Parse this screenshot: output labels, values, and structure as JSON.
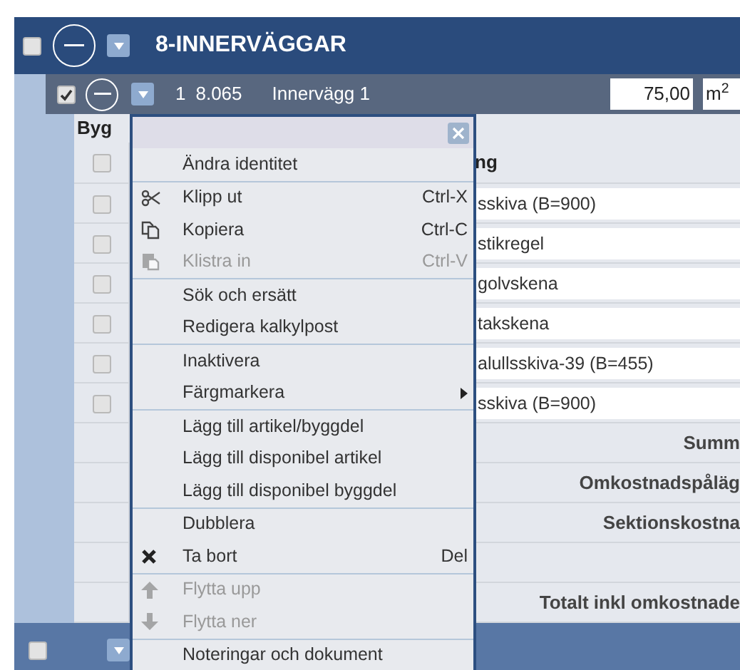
{
  "section": {
    "checked": false,
    "title": "8-INNERVÄGGAR"
  },
  "subsection": {
    "checked": true,
    "number": "1",
    "code": "8.065",
    "name": "Innervägg 1",
    "quantity": "75,00",
    "unit": "m$^{2}$"
  },
  "table": {
    "header": {
      "column_1": "Byg",
      "checked": false,
      "column_2": "ng"
    },
    "rows": [
      {
        "checked": false,
        "text": "sskiva (B=900)"
      },
      {
        "checked": false,
        "text": "stikregel"
      },
      {
        "checked": false,
        "text": "golvskena"
      },
      {
        "checked": false,
        "text": "takskena"
      },
      {
        "checked": false,
        "text": "alullsskiva-39 (B=455)"
      },
      {
        "checked": false,
        "text": "sskiva (B=900)"
      }
    ],
    "summary_rows": [
      {
        "label": "Summ"
      },
      {
        "label": "Omkostnadspåläg"
      },
      {
        "label": "Sektionskostna"
      },
      {
        "label": ""
      },
      {
        "label": "Totalt inkl omkostnade"
      }
    ]
  },
  "context_menu": {
    "items": [
      {
        "kind": "plain",
        "label": "Ändra identitet",
        "disabled": false
      },
      {
        "kind": "separator"
      },
      {
        "kind": "cut",
        "label": "Klipp ut",
        "shortcut": "Ctrl-X",
        "disabled": false
      },
      {
        "kind": "copy",
        "label": "Kopiera",
        "shortcut": "Ctrl-C",
        "disabled": false
      },
      {
        "kind": "paste",
        "label": "Klistra in",
        "shortcut": "Ctrl-V",
        "disabled": true
      },
      {
        "kind": "separator"
      },
      {
        "kind": "plain",
        "label": "Sök och ersätt",
        "disabled": false
      },
      {
        "kind": "plain",
        "label": "Redigera kalkylpost",
        "disabled": false
      },
      {
        "kind": "separator"
      },
      {
        "kind": "plain",
        "label": "Inaktivera",
        "disabled": false
      },
      {
        "kind": "submenu",
        "label": "Färgmarkera",
        "disabled": false
      },
      {
        "kind": "separator"
      },
      {
        "kind": "plain",
        "label": "Lägg till artikel/byggdel",
        "disabled": false
      },
      {
        "kind": "plain",
        "label": "Lägg till disponibel artikel",
        "disabled": false
      },
      {
        "kind": "plain",
        "label": "Lägg till disponibel byggdel",
        "disabled": false
      },
      {
        "kind": "separator"
      },
      {
        "kind": "plain",
        "label": "Dubblera",
        "disabled": false
      },
      {
        "kind": "delete",
        "label": "Ta bort",
        "shortcut": "Del",
        "disabled": false
      },
      {
        "kind": "separator"
      },
      {
        "kind": "up",
        "label": "Flytta upp",
        "disabled": true
      },
      {
        "kind": "down",
        "label": "Flytta ner",
        "disabled": true
      },
      {
        "kind": "separator"
      },
      {
        "kind": "plain",
        "label": "Noteringar och dokument",
        "disabled": false
      }
    ]
  },
  "footer_row": {
    "checked": false
  }
}
